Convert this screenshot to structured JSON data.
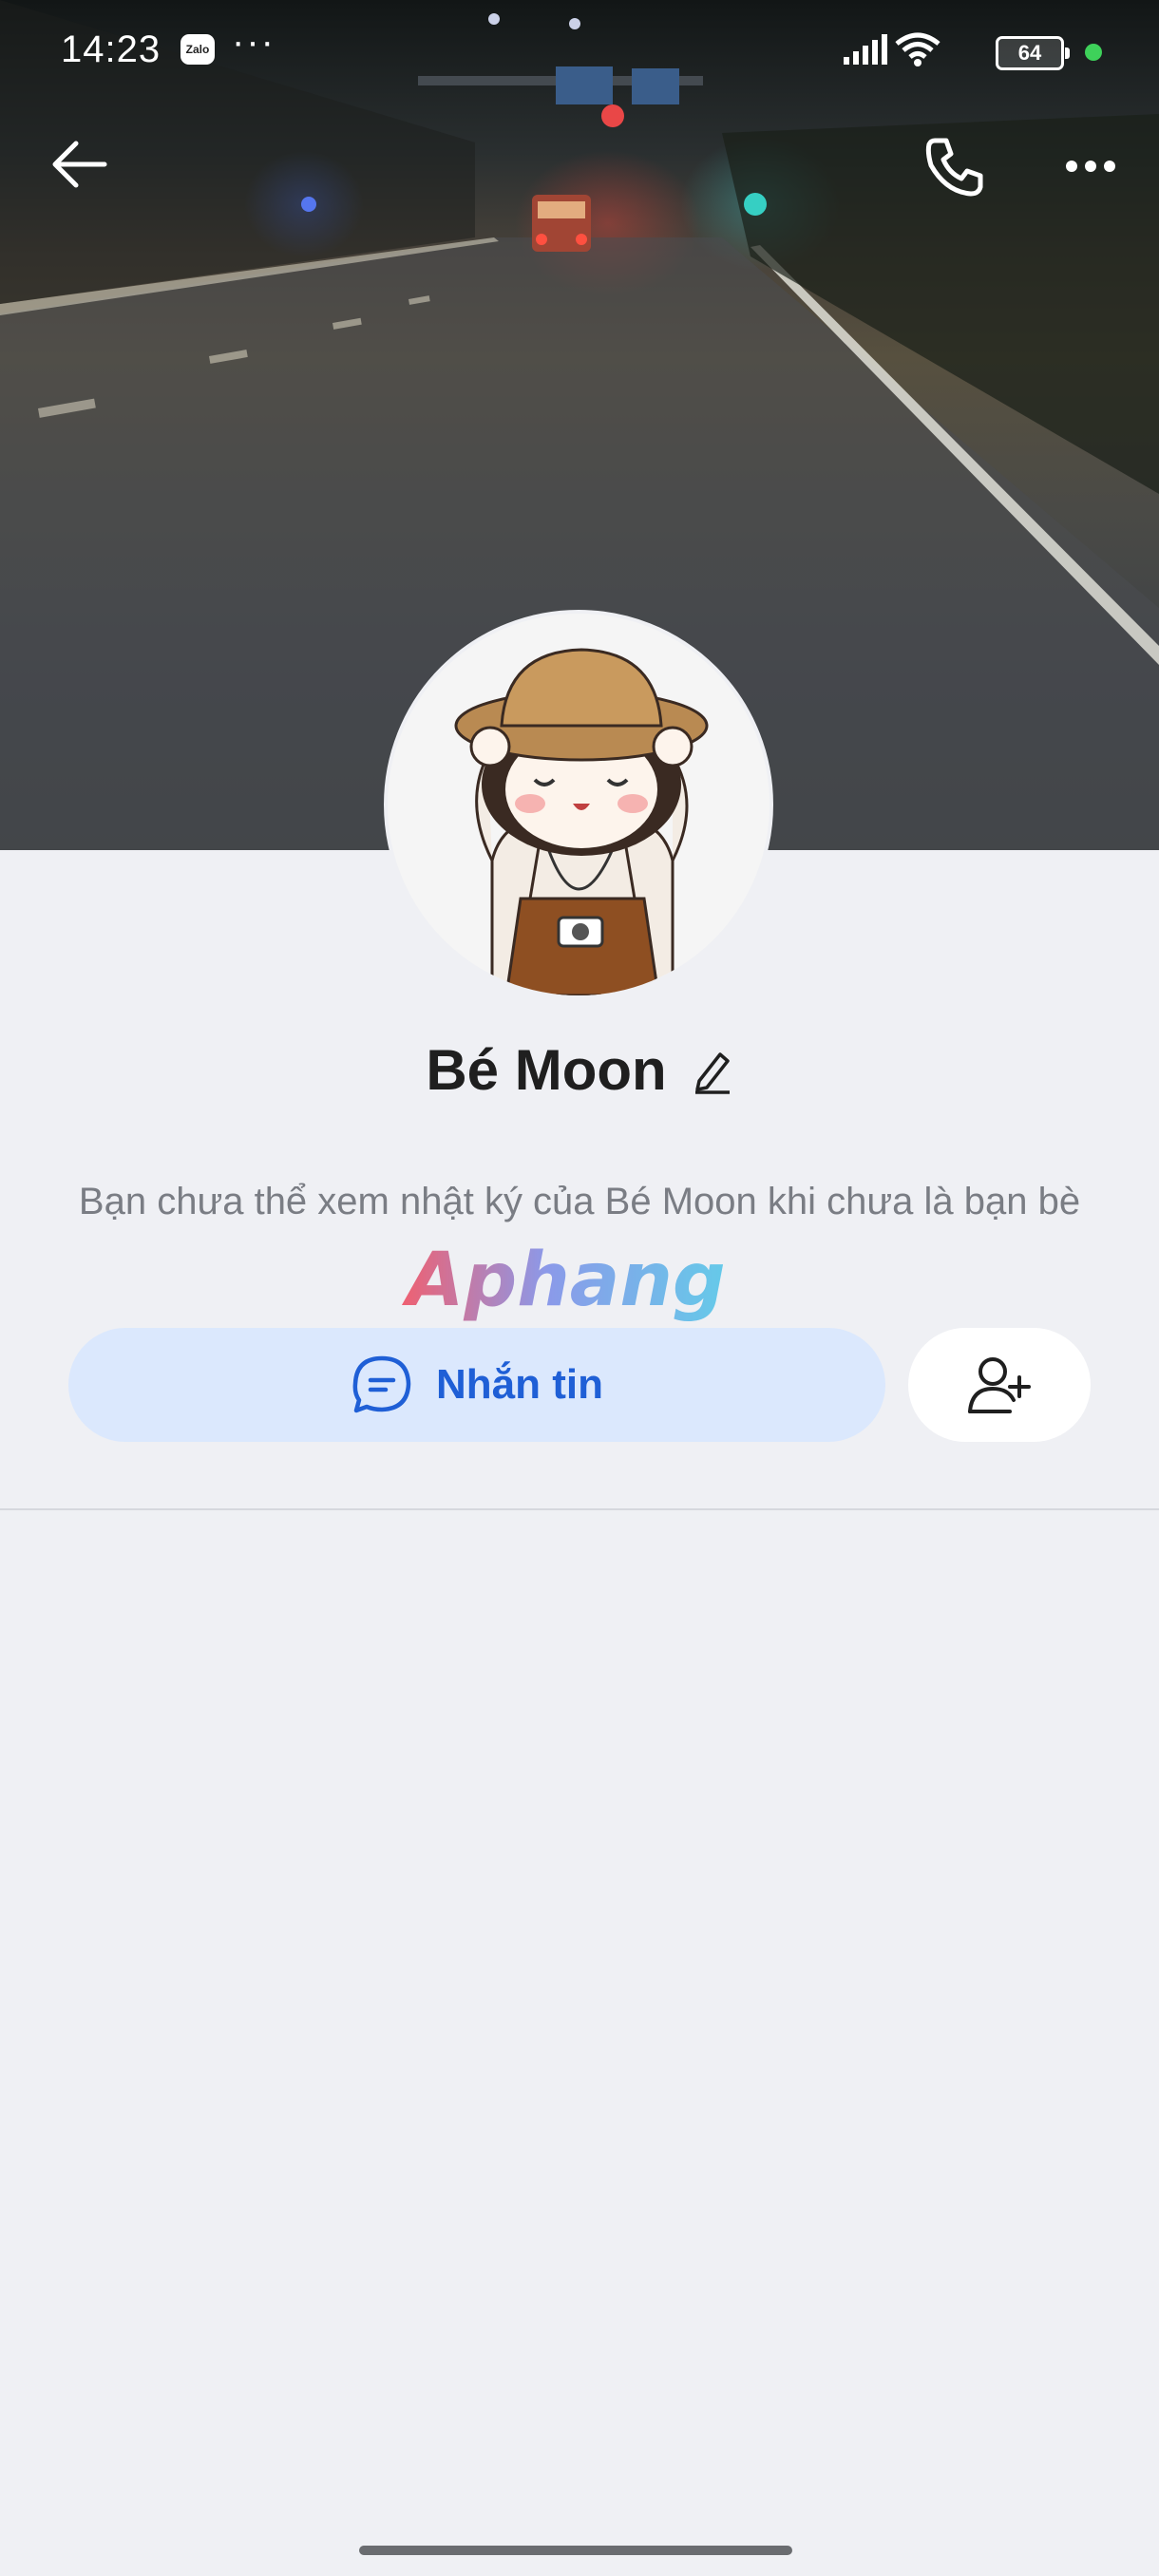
{
  "status_bar": {
    "time": "14:23",
    "app_badge": "Zalo",
    "more": "···",
    "battery": "64"
  },
  "profile": {
    "name": "Bé Moon",
    "notice": "Bạn chưa thể xem nhật ký của Bé Moon khi chưa là bạn bè"
  },
  "actions": {
    "message_label": "Nhắn tin"
  },
  "watermark": "Aphang",
  "icons": {
    "back": "arrow-left-icon",
    "call": "phone-icon",
    "more": "more-dots-icon",
    "edit": "pencil-icon",
    "message": "chat-bubble-icon",
    "add_friend": "add-user-icon"
  },
  "colors": {
    "accent": "#1f5fd6",
    "message_button_bg": "#dbe8fd",
    "page_bg": "#eff0f4"
  }
}
